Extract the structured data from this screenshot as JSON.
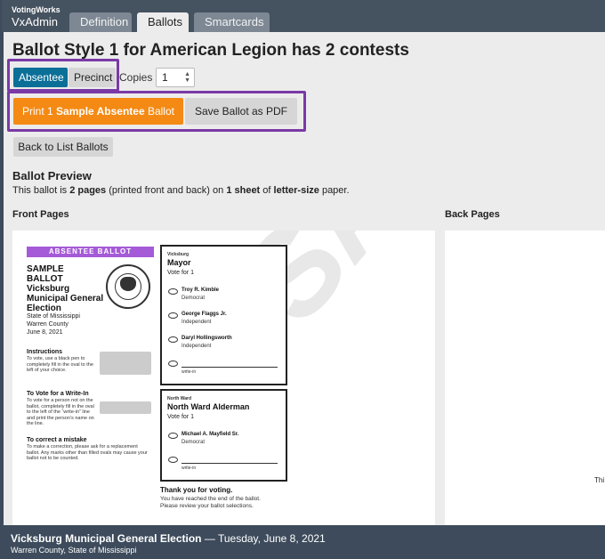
{
  "brand": {
    "org": "VotingWorks",
    "app": "VxAdmin"
  },
  "tabs": [
    {
      "label": "Definition"
    },
    {
      "label": "Ballots"
    },
    {
      "label": "Smartcards"
    }
  ],
  "page_title": "Ballot Style 1 for American Legion has 2 contests",
  "ballot_type": {
    "absentee": "Absentee",
    "precinct": "Precinct",
    "selected": "Absentee"
  },
  "copies": {
    "label": "Copies",
    "value": "1"
  },
  "print_button": {
    "prefix": "Print 1 ",
    "bold": "Sample Absentee",
    "suffix": " Ballot"
  },
  "save_pdf_label": "Save Ballot as PDF",
  "back_label": "Back to List Ballots",
  "preview": {
    "heading": "Ballot Preview",
    "desc_1": "This ballot is ",
    "desc_pages": "2 pages",
    "desc_2": " (printed front and back) on ",
    "desc_sheet": "1 sheet",
    "desc_3": " of ",
    "desc_size": "letter-size",
    "desc_4": " paper.",
    "front_heading": "Front Pages",
    "back_heading": "Back Pages",
    "back_fragment": "Thi"
  },
  "ballot": {
    "banner": "ABSENTEE BALLOT",
    "head_1": "SAMPLE",
    "head_2": "BALLOT",
    "head_3": "Vicksburg",
    "head_4": "Municipal General",
    "head_5": "Election",
    "sub_1": "State of Mississippi",
    "sub_2": "Warren County",
    "sub_3": "June 8, 2021",
    "instr_h": "Instructions",
    "instr_t": "To vote, use a black pen to completely fill in the oval to the left of your choice.",
    "writein_h": "To Vote for a Write-In",
    "writein_t": "To vote for a person not on the ballot, completely fill in the oval to the left of the “write-in” line and print the person’s name on the line.",
    "mistake_h": "To correct a mistake",
    "mistake_t": "To make a correction, please ask for a replacement ballot. Any marks other than filled ovals may cause your ballot not to be counted.",
    "watermark": "SAMPLE",
    "contests": [
      {
        "jurisdiction": "Vicksburg",
        "title": "Mayor",
        "vote_for": "Vote for 1",
        "candidates": [
          {
            "name": "Troy R. Kimble",
            "party": "Democrat"
          },
          {
            "name": "George Flaggs Jr.",
            "party": "Independent"
          },
          {
            "name": "Daryl Hollingsworth",
            "party": "Independent"
          }
        ],
        "writein": "write-in"
      },
      {
        "jurisdiction": "North Ward",
        "title": "North Ward Alderman",
        "vote_for": "Vote for 1",
        "candidates": [
          {
            "name": "Michael A. Mayfield Sr.",
            "party": "Democrat"
          }
        ],
        "writein": "write-in"
      }
    ],
    "thanks_h": "Thank you for voting.",
    "thanks_t": "You have reached the end of the ballot. Please review your ballot selections."
  },
  "footer": {
    "election": "Vicksburg Municipal General Election",
    "sep": " — ",
    "date": "Tuesday, June 8, 2021",
    "location": "Warren County, State of Mississippi"
  },
  "colors": {
    "header_bg": "#45525f",
    "active_tab": "#ececec",
    "absentee_selected": "#0b6f98",
    "print_button": "#f48a14",
    "highlight_outline": "#7a3aa6",
    "ballot_banner": "#a55ad8"
  }
}
